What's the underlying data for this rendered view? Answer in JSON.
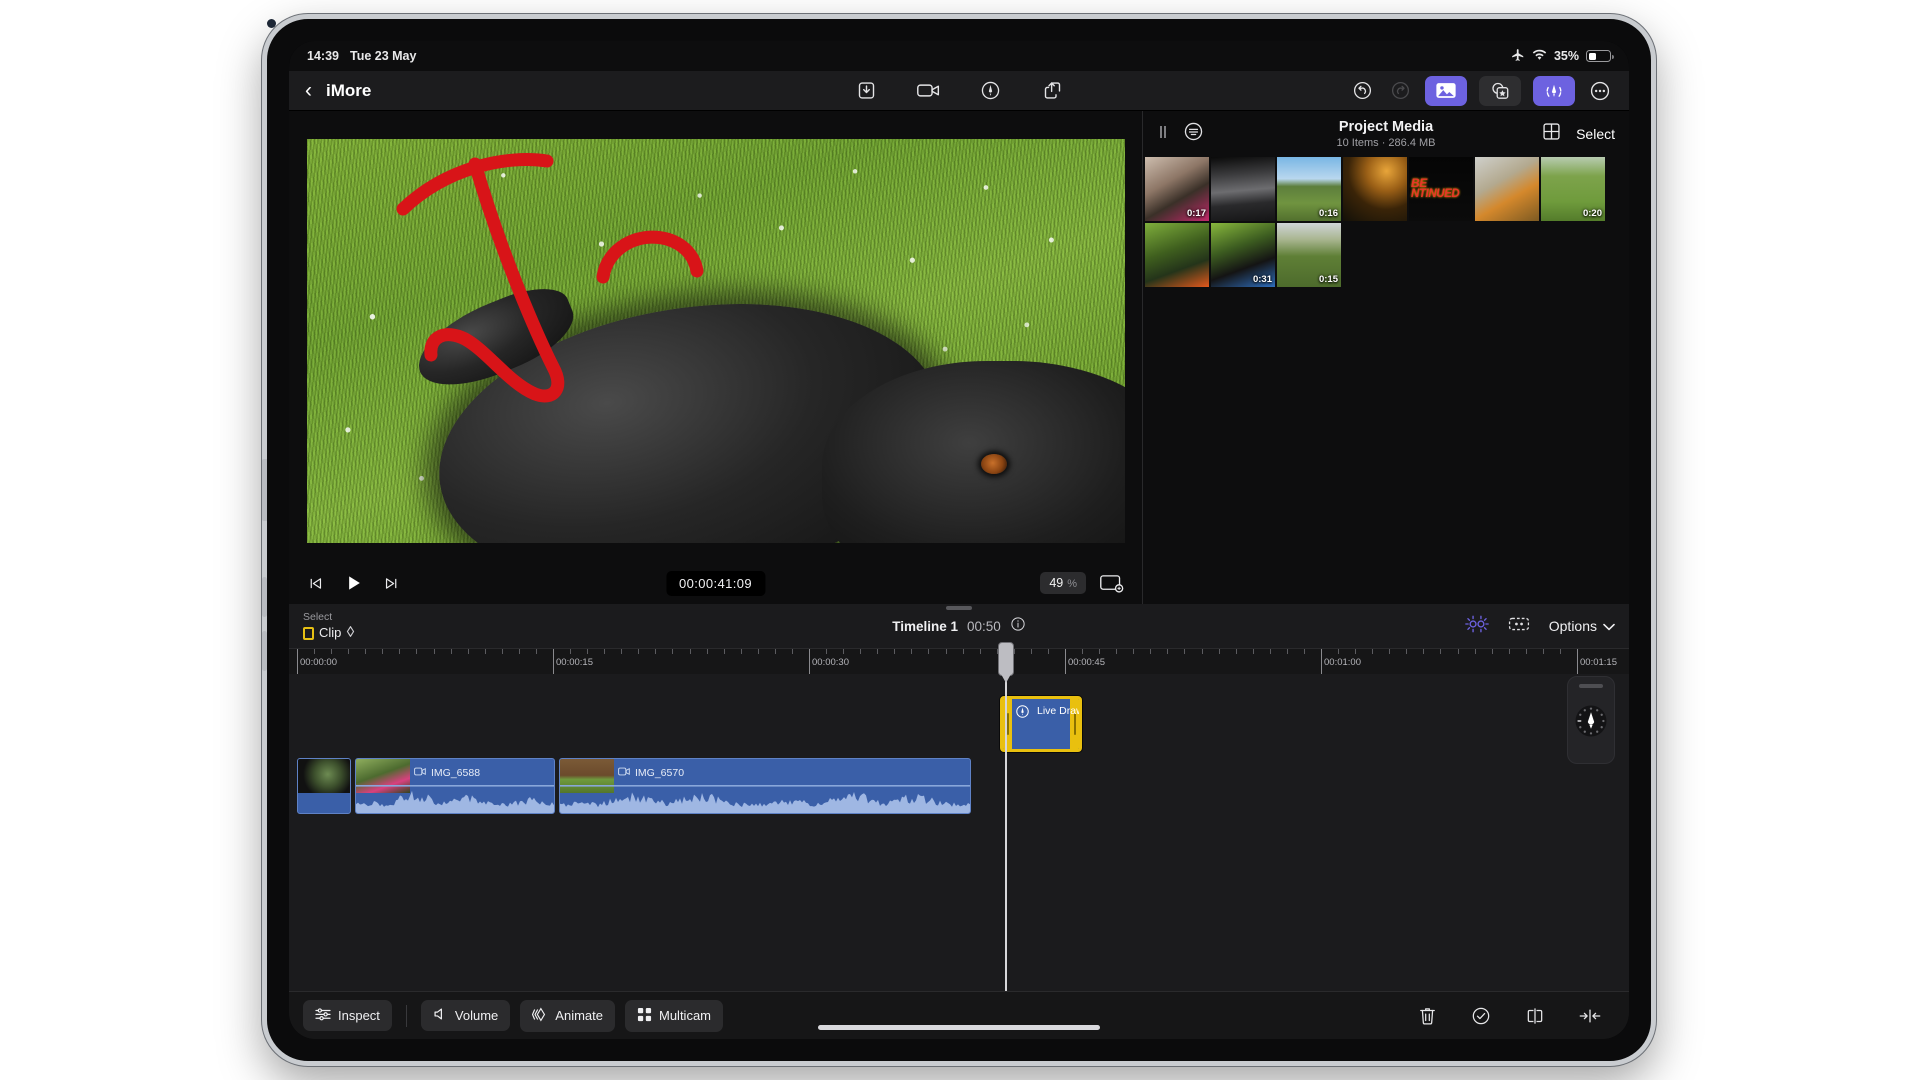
{
  "status_bar": {
    "time": "14:39",
    "date": "Tue 23 May",
    "airplane_icon": "airplane-icon",
    "wifi_icon": "wifi-icon",
    "battery_percent": "35%",
    "battery_level": 35
  },
  "nav_bar": {
    "back_icon": "chevron-left-icon",
    "project_title": "iMore",
    "center_tools": [
      {
        "name": "import-icon",
        "label": "Import"
      },
      {
        "name": "record-video-icon",
        "label": "Record Video"
      },
      {
        "name": "live-draw-icon",
        "label": "Live Drawing"
      },
      {
        "name": "share-icon",
        "label": "Share"
      }
    ],
    "right_tools": [
      {
        "name": "undo-icon",
        "label": "Undo",
        "state": "enabled"
      },
      {
        "name": "redo-icon",
        "label": "Redo",
        "state": "disabled"
      },
      {
        "name": "media-browser-icon",
        "label": "Media Browser",
        "state": "active"
      },
      {
        "name": "effects-icon",
        "label": "Effects",
        "state": "enabled"
      },
      {
        "name": "live-draw-panel-icon",
        "label": "Live Draw",
        "state": "active"
      },
      {
        "name": "more-options-icon",
        "label": "More"
      }
    ]
  },
  "viewer": {
    "transport": {
      "skip_back_icon": "skip-to-start-icon",
      "play_icon": "play-icon",
      "skip_forward_icon": "skip-to-end-icon",
      "timecode": "00:00:41:09",
      "zoom_value": "49",
      "zoom_unit": "%",
      "fit_icon": "viewer-fit-icon"
    },
    "annotation_color": "#d81418"
  },
  "media_browser": {
    "pause_icon": "pause-icon",
    "filter_icon": "filter-icon",
    "title": "Project Media",
    "subtitle": "10 Items  ·  286.4 MB",
    "grid_icon": "grid-view-icon",
    "select_label": "Select",
    "items": [
      {
        "duration": "0:17",
        "kind": "cat-on-sofa"
      },
      {
        "duration": "",
        "kind": "game-corridor"
      },
      {
        "duration": "0:16",
        "kind": "field-sky"
      },
      {
        "duration": "",
        "kind": "dog-portrait-sunset"
      },
      {
        "duration": "",
        "kind": "to-be-continued-title"
      },
      {
        "duration": "",
        "kind": "bowser-plush-hallway"
      },
      {
        "duration": "0:20",
        "kind": "dog-running-field"
      },
      {
        "duration": "",
        "kind": "dog-in-bushes-ball"
      },
      {
        "duration": "0:31",
        "kind": "dog-with-blue-toy"
      },
      {
        "duration": "0:15",
        "kind": "crop-field"
      }
    ]
  },
  "timeline": {
    "select_caption": "Select",
    "select_value": "Clip",
    "select_chevron_icon": "updown-chevron-icon",
    "name": "Timeline 1",
    "duration": "00:50",
    "info_icon": "info-circle-icon",
    "snapping_icon": "snapping-icon",
    "auto_edit_icon": "auto-edit-icon",
    "options_label": "Options",
    "options_chevron_icon": "chevron-down-icon",
    "ruler_labels": [
      "00:00:00",
      "00:00:15",
      "00:00:30",
      "00:00:45",
      "00:01:00",
      "00:01:15"
    ],
    "playhead_time": "00:00:41:09",
    "overlay_clip": {
      "label": "Live Draw",
      "badge_icon": "live-draw-badge-icon",
      "selected": true,
      "selection_color": "#e9c00f"
    },
    "video_clips": [
      {
        "label": "",
        "icon": ""
      },
      {
        "label": "IMG_6588",
        "icon": "video-clip-icon"
      },
      {
        "label": "IMG_6570",
        "icon": "video-clip-icon"
      }
    ]
  },
  "pen_palette": {
    "tool_icon": "pen-tip-icon",
    "dial_icon": "color-dial-icon"
  },
  "bottom_bar": {
    "tools": [
      {
        "label": "Inspect",
        "icon": "sliders-icon"
      },
      {
        "label": "Volume",
        "icon": "speaker-icon"
      },
      {
        "label": "Animate",
        "icon": "animate-icon"
      },
      {
        "label": "Multicam",
        "icon": "multicam-grid-icon"
      }
    ],
    "actions": [
      {
        "name": "delete-icon",
        "label": "Delete"
      },
      {
        "name": "approve-icon",
        "label": "Approve"
      },
      {
        "name": "split-icon",
        "label": "Split"
      },
      {
        "name": "close-gap-icon",
        "label": "Close Gap"
      }
    ]
  },
  "colors": {
    "accent": "#6d62e0",
    "selection": "#e9c00f",
    "clip_blue": "#3a5fa8",
    "annotation_red": "#d81418"
  }
}
